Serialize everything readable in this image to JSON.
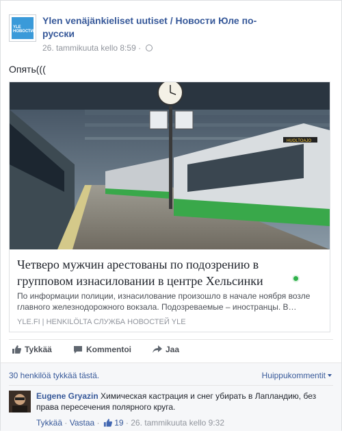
{
  "post": {
    "page_name": "Ylen venäjänkieliset uutiset / Новости Юле по-русски",
    "avatar_text": "YLE НОВОСТИ",
    "timestamp": "26. tammikuuta kello 8:59",
    "separator": "·",
    "text": "Опять((("
  },
  "link": {
    "headline": "Четверо мужчин арестованы по подозрению в групповом изнасиловании в центре Хельсинки",
    "description": "По информации полиции, изнасилование произошло в начале ноября возле главного железнодорожного вокзала. Подозреваемые – иностранцы. В…",
    "source": "YLE.FI | HENKILÖLTA СЛУЖБА НОВОСТЕЙ YLE",
    "train_sign": "HUOLTOAJO"
  },
  "actions": {
    "like": "Tykkää",
    "comment": "Kommentoi",
    "share": "Jaa"
  },
  "reactions": {
    "likes_text": "30 henkilöä tykkää tästä.",
    "sort_label": "Huippukommentit"
  },
  "comments": [
    {
      "author": "Eugene Gryazin",
      "text": "Химическая кастрация и снег убирать в Лапландию, без права пересечения полярного круга.",
      "like_label": "Tykkää",
      "reply_label": "Vastaa",
      "like_count": "19",
      "time": "26. tammikuuta kello 9:32",
      "dot": "·"
    }
  ],
  "colors": {
    "link": "#365899",
    "muted": "#90949c",
    "yle_green": "#2fb14a"
  }
}
